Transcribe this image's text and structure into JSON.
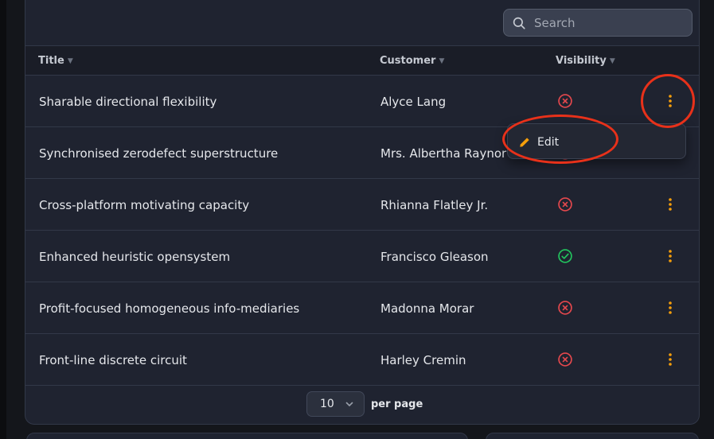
{
  "search": {
    "placeholder": "Search"
  },
  "table": {
    "columns": [
      {
        "label": "Title"
      },
      {
        "label": "Customer"
      },
      {
        "label": "Visibility"
      }
    ],
    "rows": [
      {
        "title": "Sharable directional flexibility",
        "customer": "Alyce Lang",
        "visibility": "hidden"
      },
      {
        "title": "Synchronised zerodefect superstructure",
        "customer": "Mrs. Albertha Raynor",
        "visibility": "hidden"
      },
      {
        "title": "Cross-platform motivating capacity",
        "customer": "Rhianna Flatley Jr.",
        "visibility": "hidden"
      },
      {
        "title": "Enhanced heuristic opensystem",
        "customer": "Francisco Gleason",
        "visibility": "visible"
      },
      {
        "title": "Profit-focused homogeneous info-mediaries",
        "customer": "Madonna Morar",
        "visibility": "hidden"
      },
      {
        "title": "Front-line discrete circuit",
        "customer": "Harley Cremin",
        "visibility": "hidden"
      }
    ]
  },
  "dropdown": {
    "edit_label": "Edit"
  },
  "pagination": {
    "per_page_value": "10",
    "per_page_label": "per page"
  },
  "colors": {
    "accent": "#f59e0b",
    "danger": "#e5484d",
    "success": "#22c55e",
    "annotation": "#e8311a"
  },
  "icons": {
    "search": "search-icon",
    "hidden": "x-circle-icon",
    "visible": "check-circle-icon",
    "actions": "dots-vertical-icon",
    "edit": "pencil-icon"
  }
}
